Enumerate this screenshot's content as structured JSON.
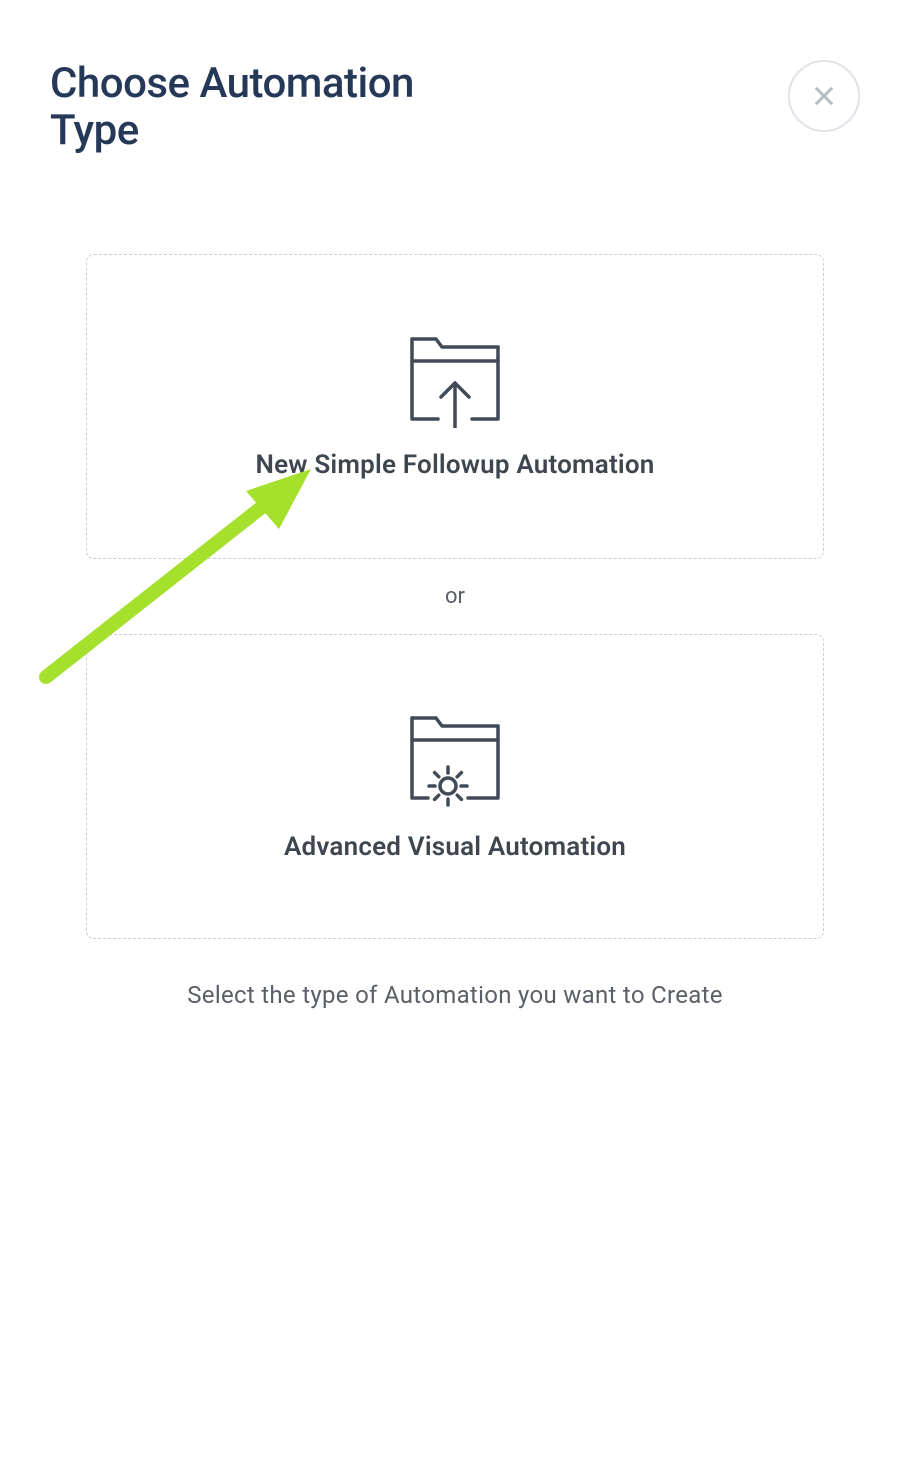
{
  "header": {
    "title": "Choose Automation Type"
  },
  "options": {
    "simple": {
      "label": "New Simple Followup Automation"
    },
    "advanced": {
      "label": "Advanced Visual Automation"
    },
    "or_text": "or"
  },
  "hint": "Select the type of Automation you want to Create",
  "annotation": {
    "arrow_color": "#a4e02c"
  }
}
